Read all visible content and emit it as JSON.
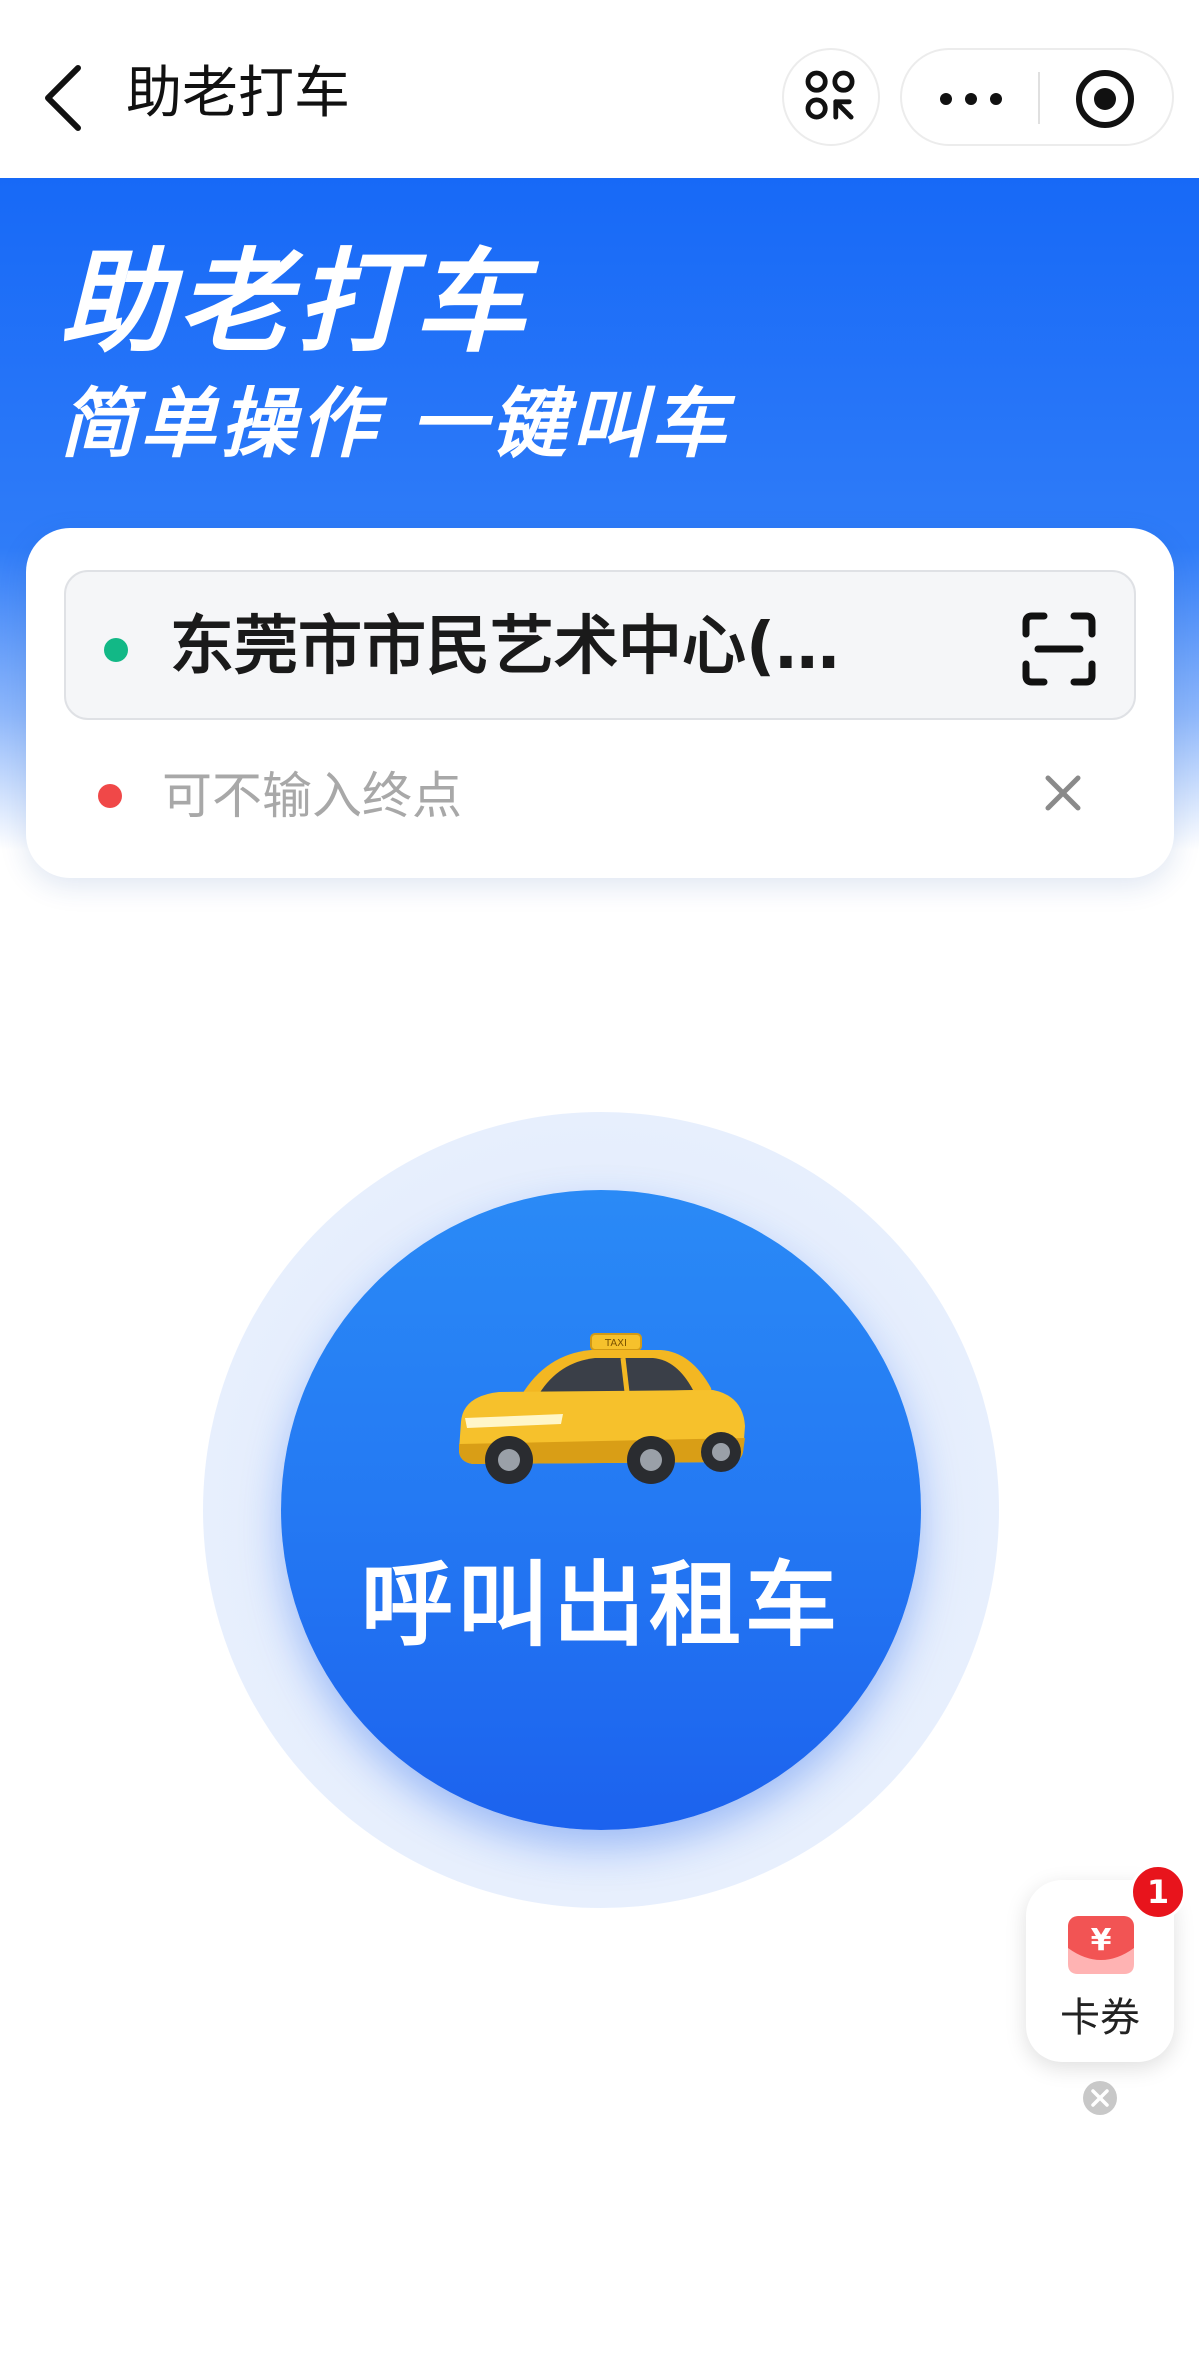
{
  "nav": {
    "title": "助老打车"
  },
  "banner": {
    "line1": "助老打车",
    "line2": "简单操作 一键叫车"
  },
  "route": {
    "start": "东莞市市民艺术中心(…",
    "end_placeholder": "可不输入终点"
  },
  "call": {
    "label": "呼叫出租车",
    "taxi_sign": "TAXI"
  },
  "coupon": {
    "label": "卡券",
    "badge_count": "1",
    "currency_symbol": "¥"
  },
  "colors": {
    "brand_blue": "#1769f7",
    "start_dot": "#12b886",
    "end_dot": "#f04848",
    "taxi_yellow": "#f6c12c",
    "badge_red": "#e8141c"
  },
  "icons": [
    "back-icon",
    "scan-grid-icon",
    "more-icon",
    "target-icon",
    "scan-frame-icon",
    "close-icon",
    "taxi-icon",
    "coupon-icon"
  ]
}
